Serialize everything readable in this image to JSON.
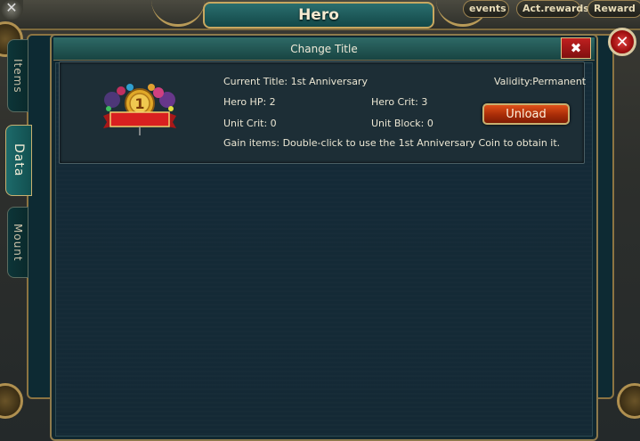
{
  "window": {
    "title": "Hero",
    "top_tabs": [
      "events",
      "Act.rewards",
      "Reward"
    ]
  },
  "side_tabs": [
    {
      "label": "Items",
      "active": false
    },
    {
      "label": "Data",
      "active": true
    },
    {
      "label": "Mount",
      "active": false
    }
  ],
  "dialog": {
    "title": "Change Title",
    "close_icon": "close-icon",
    "entry": {
      "current_title_label": "Current Title:",
      "current_title_value": "1st Anniversary",
      "validity": "Validity:Permanent",
      "hero_hp_label": "Hero HP:",
      "hero_hp_value": "2",
      "hero_crit_label": "Hero Crit:",
      "hero_crit_value": "3",
      "unit_crit_label": "Unit Crit:",
      "unit_crit_value": "0",
      "unit_block_label": "Unit Block:",
      "unit_block_value": "0",
      "gain_items_label": "Gain items:",
      "gain_items_value": "Double-click to use the 1st Anniversary Coin to obtain it.",
      "unload_label": "Unload",
      "badge_number": "1",
      "icon": "anniversary-title-badge-icon"
    }
  },
  "colors": {
    "panel_bg": "#142935",
    "accent_gold": "#c8a860",
    "unload_button": "#c03c10",
    "close_red": "#c02020",
    "header_teal": "#2a6e6e"
  }
}
